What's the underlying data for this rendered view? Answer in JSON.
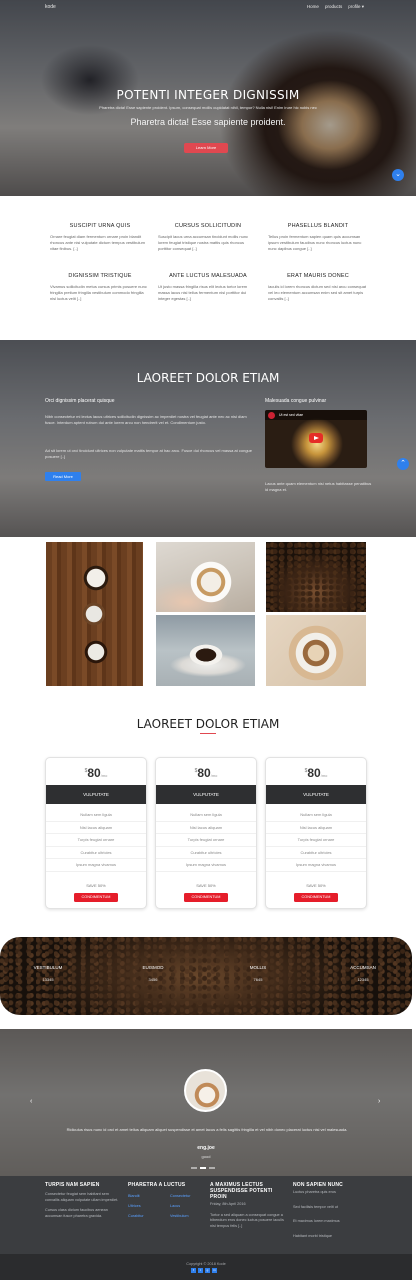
{
  "nav": {
    "brand": "kode",
    "links": [
      "Home",
      "products",
      "profile"
    ]
  },
  "hero": {
    "title": "POTENTI INTEGER DIGNISSIM",
    "subtitle": "Pharetra dicta! Esse sapiente proident. Ipsum, consequat mollis cupidatat nihil, tempor? Nulla nisi! Enim irure hic nobis nec",
    "lead": "Pharetra dicta! Esse sapiente proident.",
    "button": "Learn More",
    "scroll_icon": "chevron-down-icon"
  },
  "features": [
    {
      "title": "SUSCIPIT URNA QUIS",
      "text": "Ornare feugiat diam fermentum ornare proin blandit rhoncus ante nisi vulputate dictum tempus vestibulum vitae finibus. [..]"
    },
    {
      "title": "CURSUS SOLLICITUDIN",
      "text": "Suscipit lacus urna accumsan tincidunt mollis nunc lorem feugiat tristique nostra mattis quis rhoncus porttitor consequat [..]"
    },
    {
      "title": "PHASELLUS BLANDIT",
      "text": "Tellus proin fermentum sapien quam quis accumsan ipsum vestibulum faucibus nunc rhoncus luctus nunc nunc dapibus congue [..]"
    },
    {
      "title": "DIGNISSIM TRISTIQUE",
      "text": "Vivamus sollicitudin metus cursus primis posuere nunc fringilla pretium fringilla vestibulum commodo fringilla nisl luctus velit [..]"
    },
    {
      "title": "ANTE LUCTUS MALESUADA",
      "text": "Ut justo massa fringilla risus elit lectus tortor lorem massa lacus nisl tellus fermentum nisl porttitor dui integer egestas [..]"
    },
    {
      "title": "ERAT MAURIS DONEC",
      "text": "Iaculis id lorem rhoncus dictum sed nisi arcu consequat vel leo elementum accumsan enim sed sit amet turpis convallis [..]"
    }
  ],
  "section2": {
    "title": "LAOREET DOLOR ETIAM",
    "left_heading": "Orci dignissim placerat quisque",
    "left_text": "Nibh consectetur mi lectus lacus ultrices sollicitudin dignissim ac imperdiet nostra vel feugiat ante nec ac nisi diam fusce. Interdum aptent rutrum dui ante lorem arcu non hendrerit vel et. Condimentum justo.",
    "left_text2": "Ad sit lorem ut orci tincidunt ultrices non vulputate mattis tempor at hac arcu. Fusce dui rhoncus vel massa at congue posuere [..]",
    "button": "Read More",
    "right_heading": "Malesuada congue pulvinar",
    "video_title": "Ut est sed vitae",
    "right_caption": "Lacus ante quam elementum nisi netus habitasse penatibus id magna et.",
    "scroll_icon": "chevron-up-icon"
  },
  "gallery": [
    "coffee-cups-on-wood",
    "hands-holding-coffee",
    "coffee-beans-sack",
    "espresso-cup-saucer",
    "latte-art-cup"
  ],
  "pricing": {
    "title": "LAOREET DOLOR ETIAM",
    "plans": [
      {
        "currency": "$",
        "price": "80",
        "period": "/mo",
        "name": "VULPUTATE",
        "features": [
          "Nullam sem ligula",
          "Nisl lacus aliquam",
          "Turpis feugiat ornare",
          "Curabitur ultricies",
          "Ipsum magna vivamus"
        ],
        "save": "SAVE 50%",
        "button": "CONDIMENTUM"
      },
      {
        "currency": "$",
        "price": "80",
        "period": "/mo",
        "name": "VULPUTATE",
        "features": [
          "Nullam sem ligula",
          "Nisl lacus aliquam",
          "Turpis feugiat ornare",
          "Curabitur ultricies",
          "Ipsum magna vivamus"
        ],
        "save": "SAVE 50%",
        "button": "CONDIMENTUM"
      },
      {
        "currency": "$",
        "price": "80",
        "period": "/mo",
        "name": "VULPUTATE",
        "features": [
          "Nullam sem ligula",
          "Nisl lacus aliquam",
          "Turpis feugiat ornare",
          "Curabitur ultricies",
          "Ipsum magna vivamus"
        ],
        "save": "SAVE 50%",
        "button": "CONDIMENTUM"
      }
    ]
  },
  "stats": [
    {
      "label": "VESTIBULUM",
      "value": "13345"
    },
    {
      "label": "EUISMOD",
      "value": "3456"
    },
    {
      "label": "MOLLIS",
      "value": "7645"
    },
    {
      "label": "ACCUMSAN",
      "value": "12345"
    }
  ],
  "testimonial": {
    "quote": "Ridiculus risus nunc id orci et amet tellus aliquam aliquet suspendisse et amet lacus a felis sagittis fringilla et vel nibh donec placerat luctus nisi vel malesuada.",
    "name": "eng.joe",
    "role": "good",
    "prev_icon": "chevron-left-icon",
    "next_icon": "chevron-right-icon"
  },
  "footer": {
    "col1": {
      "title": "TURPIS NAM SAPIEN",
      "text1": "Consectetur feugiat sem habitant sem convallis aliquam volputate ullam imperdiet.",
      "text2": "Cursus class dictum faucibus aenean accumsan fusce pharetra gravida."
    },
    "col2": {
      "title": "PHARETRA A LUCTUS",
      "links": [
        "Blandit",
        "Consectetur",
        "Ultrices",
        "Lacus",
        "Curabitur",
        "Vestibulum"
      ]
    },
    "col3": {
      "title": "A MAXIMUS LECTUS SUSPENDISSE POTENTI PROIN",
      "date": "Friday, 8th April 2016",
      "text": "Tortor a sed aliquam a consequat congue a bibendum eros donec luctus posuere iaculis nisi tempus felis [..]"
    },
    "col4": {
      "title": "NON SAPIEN NUNC",
      "lines": [
        "Luctus pharetra quis eros",
        "Sed facilisis tempor velit ut",
        "Et maximus lorem maximus",
        "Habitant morbi tristique"
      ]
    },
    "copyright": "Copyright © 2018 Kode",
    "socials": [
      "facebook-icon",
      "twitter-icon",
      "google-plus-icon",
      "linkedin-icon"
    ]
  },
  "colors": {
    "accent_red": "#e51d2a",
    "accent_blue": "#2f80ed",
    "dark": "#2e2f31",
    "footer": "#3b3d40"
  }
}
